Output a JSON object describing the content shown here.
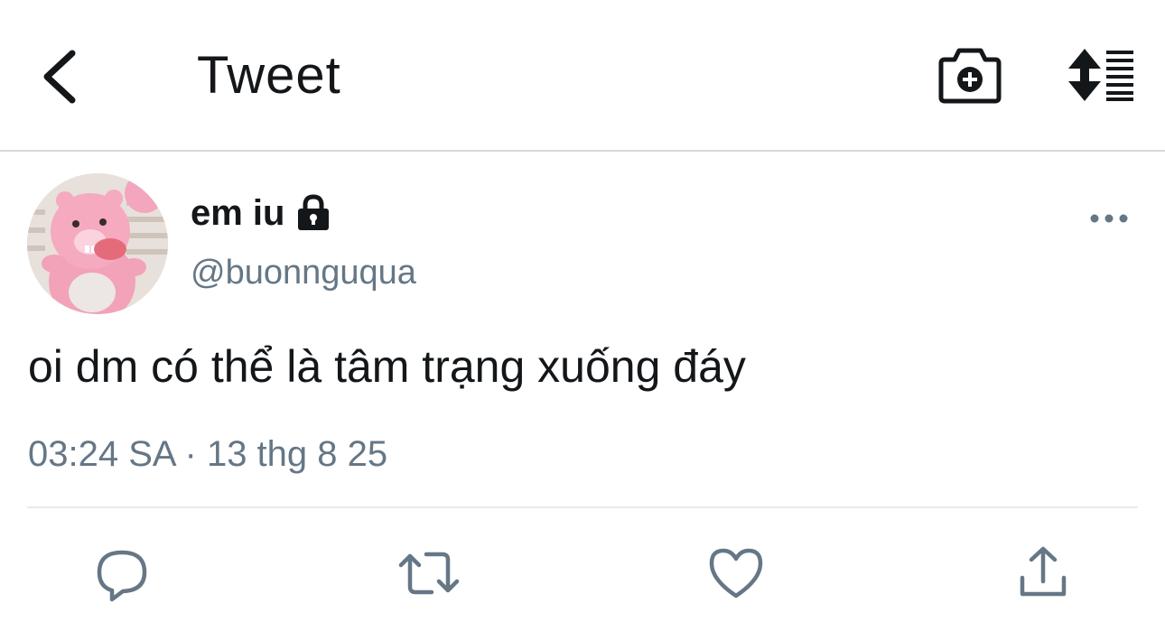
{
  "header": {
    "title": "Tweet",
    "back_icon": "chevron-left-icon",
    "camera_icon": "camera-add-icon",
    "sort_icon": "sort-list-icon"
  },
  "tweet": {
    "author": {
      "display_name": "em iu",
      "handle": "@buonnguqua",
      "protected": true,
      "avatar": "pink-bear-avatar"
    },
    "text": "oi dm có thể là tâm trạng xuống đáy",
    "time": "03:24 SA",
    "separator": "·",
    "date": "13 thg 8 25"
  },
  "actions": [
    "reply-icon",
    "retweet-icon",
    "like-icon",
    "share-icon"
  ],
  "colors": {
    "text": "#14171a",
    "secondary": "#657786",
    "action_icon": "#657786",
    "divider": "#e6ecf0"
  }
}
